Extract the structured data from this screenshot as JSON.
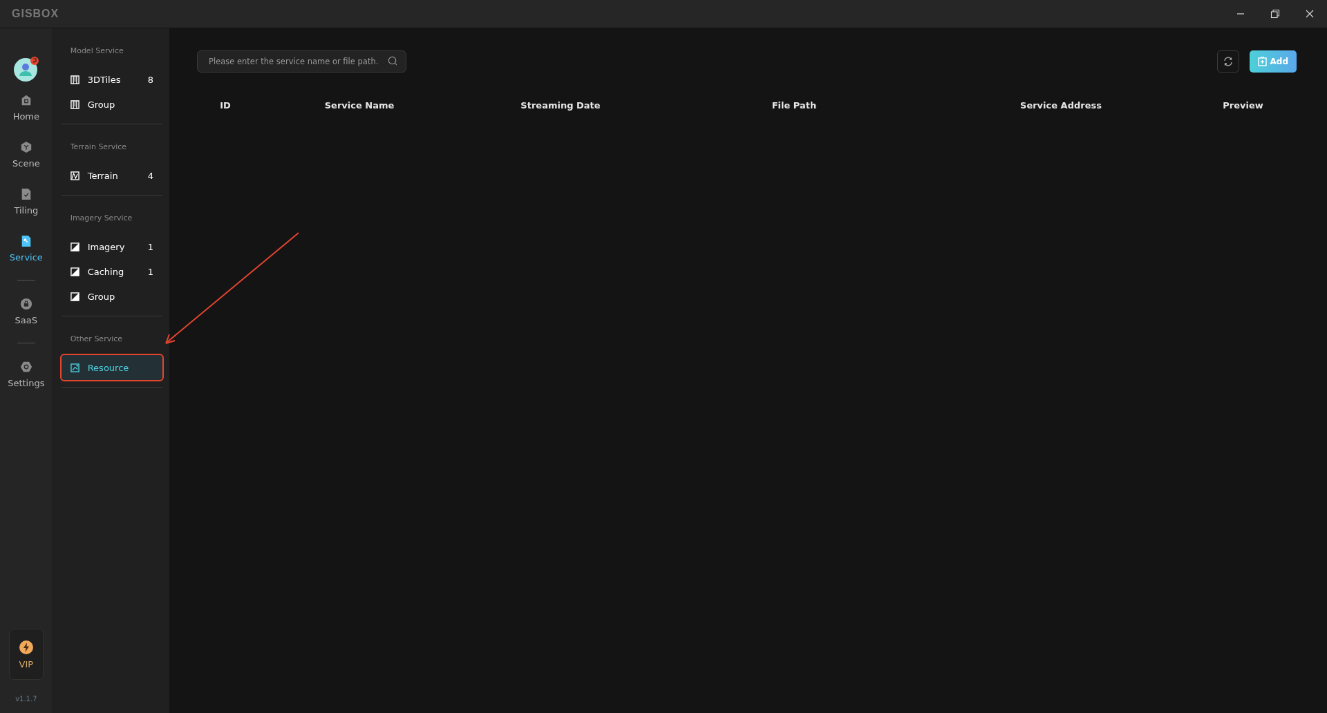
{
  "window": {
    "logo": "GISBOX"
  },
  "rail": {
    "items": [
      {
        "label": "Home",
        "selected": false
      },
      {
        "label": "Scene",
        "selected": false
      },
      {
        "label": "Tiling",
        "selected": false
      },
      {
        "label": "Service",
        "selected": true
      },
      {
        "label": "SaaS",
        "selected": false
      },
      {
        "label": "Settings",
        "selected": false
      }
    ],
    "vip": "VIP",
    "version": "v1.1.7"
  },
  "sidebar": {
    "sections": [
      {
        "title": "Model Service",
        "items": [
          {
            "label": "3DTiles",
            "count": "8",
            "selected": false,
            "highlighted": false
          },
          {
            "label": "Group",
            "selected": false,
            "highlighted": false
          }
        ]
      },
      {
        "title": "Terrain Service",
        "items": [
          {
            "label": "Terrain",
            "count": "4",
            "selected": false,
            "highlighted": false
          }
        ]
      },
      {
        "title": "Imagery Service",
        "items": [
          {
            "label": "Imagery",
            "count": "1",
            "selected": false,
            "highlighted": false
          },
          {
            "label": "Caching",
            "count": "1",
            "selected": false,
            "highlighted": false
          },
          {
            "label": "Group",
            "selected": false,
            "highlighted": false
          }
        ]
      },
      {
        "title": "Other Service",
        "items": [
          {
            "label": "Resource",
            "selected": true,
            "highlighted": true
          }
        ]
      }
    ]
  },
  "search": {
    "placeholder": "Please enter the service name or file path."
  },
  "buttons": {
    "add": "Add"
  },
  "table": {
    "columns": [
      "ID",
      "Service Name",
      "Streaming Date",
      "File Path",
      "Service Address",
      "Preview"
    ]
  }
}
